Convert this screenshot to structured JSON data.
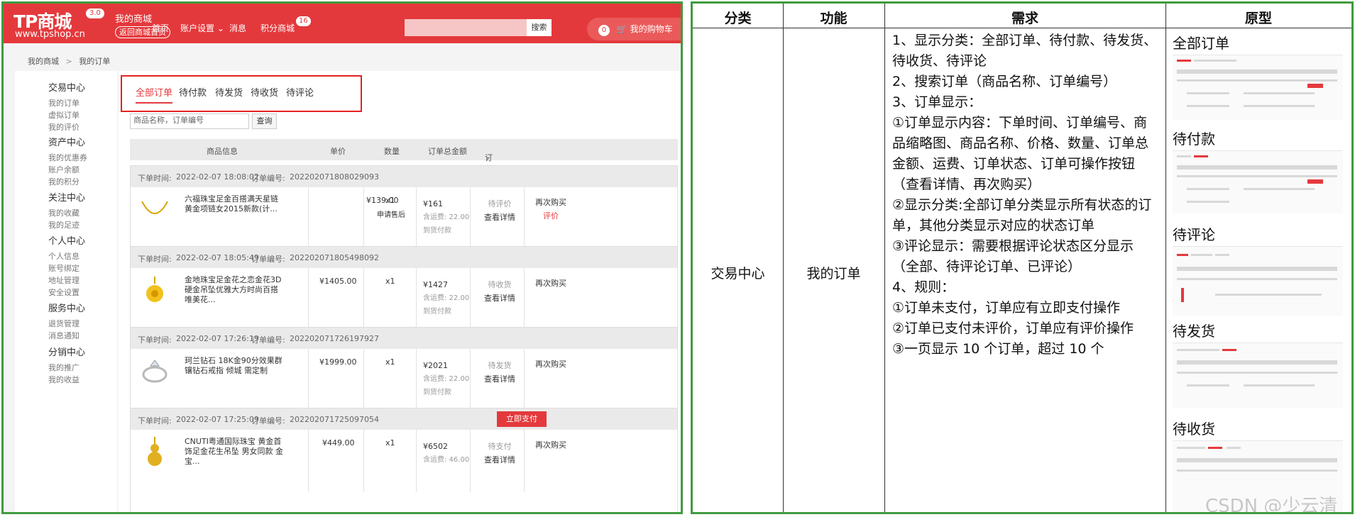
{
  "web": {
    "logo": {
      "text": "TP商城",
      "version": "3.0",
      "url": "www.tpshop.cn"
    },
    "header": {
      "mall_title": "我的商城",
      "back_label": "返回商城首页",
      "nav": [
        "首页",
        "账户设置",
        "消息",
        "积分商城"
      ],
      "msg_badge": "16",
      "search_button": "搜索",
      "cart_label": "我的购物车",
      "cart_count": "0"
    },
    "breadcrumb": [
      "我的商城",
      "我的订单"
    ],
    "sidebar": [
      {
        "group": "交易中心",
        "items": [
          "我的订单",
          "虚拟订单",
          "我的评价"
        ]
      },
      {
        "group": "资产中心",
        "items": [
          "我的优惠券",
          "账户余额",
          "我的积分"
        ]
      },
      {
        "group": "关注中心",
        "items": [
          "我的收藏",
          "我的足迹"
        ]
      },
      {
        "group": "个人中心",
        "items": [
          "个人信息",
          "账号绑定",
          "地址管理",
          "安全设置"
        ]
      },
      {
        "group": "服务中心",
        "items": [
          "退货管理",
          "消息通知"
        ]
      },
      {
        "group": "分销中心",
        "items": [
          "我的推广",
          "我的收益"
        ]
      }
    ],
    "tabs": [
      "全部订单",
      "待付款",
      "待发货",
      "待收货",
      "待评论"
    ],
    "order_search": {
      "placeholder": "商品名称，订单编号",
      "button": "查询"
    },
    "list_header": {
      "product": "商品信息",
      "price": "单价",
      "qty": "数量",
      "total": "订单总金额",
      "status": "订单状态"
    },
    "orders": [
      {
        "time_label": "下单时间:",
        "time": "2022-02-07 18:08:02",
        "no_label": "订单编号:",
        "no": "202202071808029093",
        "name": "六福珠宝足金百搭满天星链黄金项链女2015新款(计...",
        "price": "¥139.00",
        "qty": "x1",
        "after_sale": "申请售后",
        "total": "¥161",
        "freight": "含运费: 22.00",
        "pay_type": "到货付款",
        "status": "待评价",
        "detail": "查看详情",
        "buy_again": "再次购买",
        "rate": "评价"
      },
      {
        "time_label": "下单时间:",
        "time": "2022-02-07 18:05:49",
        "no_label": "订单编号:",
        "no": "202202071805498092",
        "name": "金地珠宝足金花之恋金花3D硬金吊坠优雅大方时尚百搭唯美花...",
        "price": "¥1405.00",
        "qty": "x1",
        "total": "¥1427",
        "freight": "含运费: 22.00",
        "pay_type": "到货付款",
        "status": "待收货",
        "detail": "查看详情",
        "buy_again": "再次购买"
      },
      {
        "time_label": "下单时间:",
        "time": "2022-02-07 17:26:19",
        "no_label": "订单编号:",
        "no": "202202071726197927",
        "name": "珂兰钻石 18K金90分效果群镶钻石戒指 倾城 需定制",
        "price": "¥1999.00",
        "qty": "x1",
        "total": "¥2021",
        "freight": "含运费: 22.00",
        "pay_type": "到货付款",
        "status": "待发货",
        "detail": "查看详情",
        "buy_again": "再次购买"
      },
      {
        "time_label": "下单时间:",
        "time": "2022-02-07 17:25:09",
        "no_label": "订单编号:",
        "no": "202202071725097054",
        "pay_now": "立即支付",
        "name": "CNUTI粤通国际珠宝 黄金首饰足金花生吊坠 男女同款 金宝...",
        "price": "¥449.00",
        "qty": "x1",
        "total": "¥6502",
        "freight": "含运费: 46.00",
        "status": "待支付",
        "detail": "查看详情",
        "buy_again": "再次购买"
      }
    ],
    "colors": {
      "brand_red": "#e4393c",
      "frame_green": "#3f9b3f"
    }
  },
  "table": {
    "headers": [
      "分类",
      "功能",
      "需求",
      "原型"
    ],
    "category": "交易中心",
    "feature": "我的订单",
    "requirements": [
      "1、显示分类：全部订单、待付款、待发货、待收货、待评论",
      "2、搜索订单（商品名称、订单编号）",
      "3、订单显示：",
      "①订单显示内容：下单时间、订单编号、商品缩略图、商品名称、价格、数量、订单总金额、运费、订单状态、订单可操作按钮（查看详情、再次购买）",
      "②显示分类:全部订单分类显示所有状态的订单，其他分类显示对应的状态订单",
      "③评论显示：需要根据评论状态区分显示（全部、待评论订单、已评论）",
      "4、规则：",
      "①订单未支付，订单应有立即支付操作",
      "②订单已支付未评价，订单应有评价操作",
      "③一页显示 10 个订单，超过 10 个"
    ],
    "prototypes": [
      "全部订单",
      "待付款",
      "待评论",
      "待发货",
      "待收货"
    ],
    "watermark": "CSDN @少云清"
  }
}
